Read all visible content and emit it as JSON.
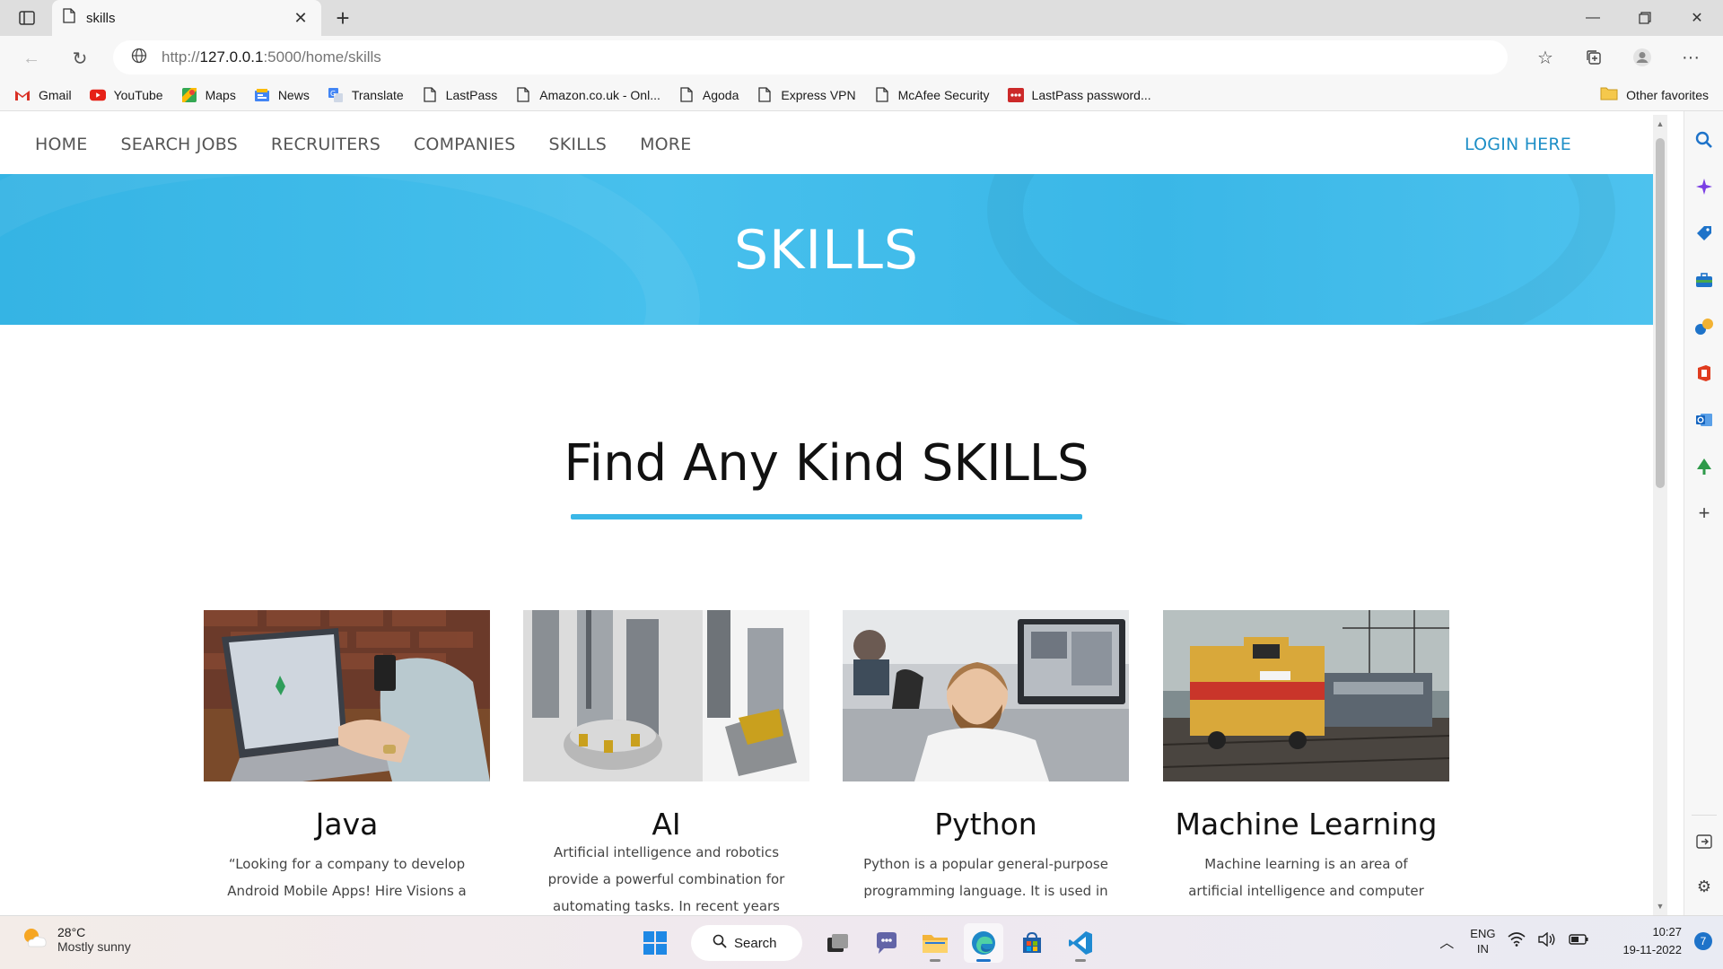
{
  "browser": {
    "tab_title": "skills",
    "url_prefix": "http://",
    "url_host": "127.0.0.1",
    "url_rest": ":5000/home/skills",
    "bookmarks": [
      {
        "label": "Gmail",
        "icon": "gmail-icon"
      },
      {
        "label": "YouTube",
        "icon": "youtube-icon"
      },
      {
        "label": "Maps",
        "icon": "maps-icon"
      },
      {
        "label": "News",
        "icon": "news-icon"
      },
      {
        "label": "Translate",
        "icon": "translate-icon"
      },
      {
        "label": "LastPass",
        "icon": "page-icon"
      },
      {
        "label": "Amazon.co.uk - Onl...",
        "icon": "page-icon"
      },
      {
        "label": "Agoda",
        "icon": "page-icon"
      },
      {
        "label": "Express VPN",
        "icon": "page-icon"
      },
      {
        "label": "McAfee Security",
        "icon": "page-icon"
      },
      {
        "label": "LastPass password...",
        "icon": "lastpass-icon"
      }
    ],
    "other_favorites": "Other favorites"
  },
  "site": {
    "nav": [
      "HOME",
      "SEARCH JOBS",
      "RECRUITERS",
      "COMPANIES",
      "SKILLS",
      "MORE"
    ],
    "login": "LOGIN HERE",
    "hero_title": "SKILLS",
    "section_title": "Find Any Kind SKILLS",
    "accent_color": "#3ab7e7",
    "cards": [
      {
        "title": "Java",
        "desc1": "“Looking for a company to develop",
        "desc2": "Android Mobile Apps! Hire Visions a"
      },
      {
        "title": "AI",
        "desc1": "Artificial intelligence and robotics",
        "desc2": "provide a powerful combination for",
        "desc3": "automating tasks. In recent years"
      },
      {
        "title": "Python",
        "desc1": "Python is a popular general-purpose",
        "desc2": "programming language. It is used in"
      },
      {
        "title": "Machine Learning",
        "desc1": "Machine learning is an area of",
        "desc2": "artificial intelligence and computer"
      }
    ]
  },
  "taskbar": {
    "temp": "28°C",
    "condition": "Mostly sunny",
    "search": "Search",
    "lang1": "ENG",
    "lang2": "IN",
    "time": "10:27",
    "date": "19-11-2022",
    "notifications": "7"
  }
}
